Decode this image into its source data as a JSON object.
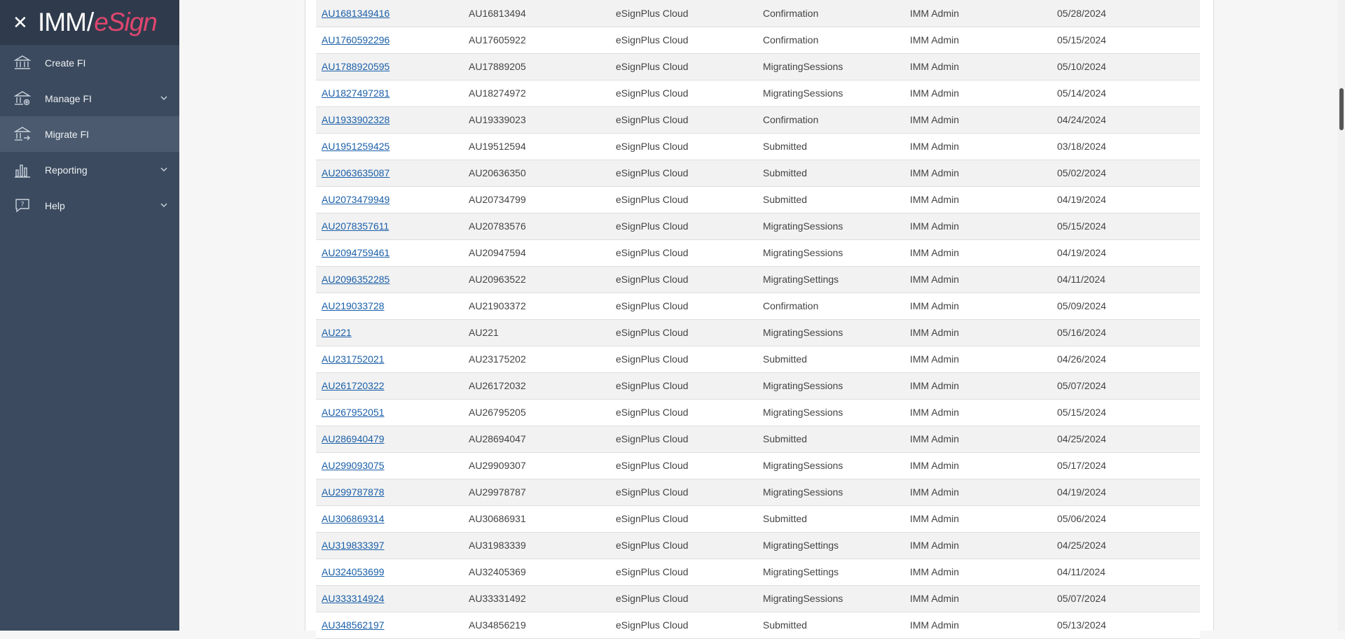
{
  "app": {
    "logo_imm": "IMM",
    "logo_slash": "/",
    "logo_esign": "eSign"
  },
  "sidebar": {
    "items": [
      {
        "label": "Create FI",
        "icon": "bank-icon"
      },
      {
        "label": "Manage FI",
        "icon": "bank-settings-icon"
      },
      {
        "label": "Migrate FI",
        "icon": "bank-migrate-icon"
      },
      {
        "label": "Reporting",
        "icon": "bar-chart-icon"
      },
      {
        "label": "Help",
        "icon": "help-bubble-icon"
      }
    ]
  },
  "table": {
    "rows": [
      [
        "AU1681349416",
        "AU16813494",
        "eSignPlus Cloud",
        "Confirmation",
        "IMM Admin",
        "05/28/2024"
      ],
      [
        "AU1760592296",
        "AU17605922",
        "eSignPlus Cloud",
        "Confirmation",
        "IMM Admin",
        "05/15/2024"
      ],
      [
        "AU1788920595",
        "AU17889205",
        "eSignPlus Cloud",
        "MigratingSessions",
        "IMM Admin",
        "05/10/2024"
      ],
      [
        "AU1827497281",
        "AU18274972",
        "eSignPlus Cloud",
        "MigratingSessions",
        "IMM Admin",
        "05/14/2024"
      ],
      [
        "AU1933902328",
        "AU19339023",
        "eSignPlus Cloud",
        "Confirmation",
        "IMM Admin",
        "04/24/2024"
      ],
      [
        "AU1951259425",
        "AU19512594",
        "eSignPlus Cloud",
        "Submitted",
        "IMM Admin",
        "03/18/2024"
      ],
      [
        "AU2063635087",
        "AU20636350",
        "eSignPlus Cloud",
        "Submitted",
        "IMM Admin",
        "05/02/2024"
      ],
      [
        "AU2073479949",
        "AU20734799",
        "eSignPlus Cloud",
        "Submitted",
        "IMM Admin",
        "04/19/2024"
      ],
      [
        "AU2078357611",
        "AU20783576",
        "eSignPlus Cloud",
        "MigratingSessions",
        "IMM Admin",
        "05/15/2024"
      ],
      [
        "AU2094759461",
        "AU20947594",
        "eSignPlus Cloud",
        "MigratingSessions",
        "IMM Admin",
        "04/19/2024"
      ],
      [
        "AU2096352285",
        "AU20963522",
        "eSignPlus Cloud",
        "MigratingSettings",
        "IMM Admin",
        "04/11/2024"
      ],
      [
        "AU219033728",
        "AU21903372",
        "eSignPlus Cloud",
        "Confirmation",
        "IMM Admin",
        "05/09/2024"
      ],
      [
        "AU221",
        "AU221",
        "eSignPlus Cloud",
        "MigratingSessions",
        "IMM Admin",
        "05/16/2024"
      ],
      [
        "AU231752021",
        "AU23175202",
        "eSignPlus Cloud",
        "Submitted",
        "IMM Admin",
        "04/26/2024"
      ],
      [
        "AU261720322",
        "AU26172032",
        "eSignPlus Cloud",
        "MigratingSessions",
        "IMM Admin",
        "05/07/2024"
      ],
      [
        "AU267952051",
        "AU26795205",
        "eSignPlus Cloud",
        "MigratingSessions",
        "IMM Admin",
        "05/15/2024"
      ],
      [
        "AU286940479",
        "AU28694047",
        "eSignPlus Cloud",
        "Submitted",
        "IMM Admin",
        "04/25/2024"
      ],
      [
        "AU299093075",
        "AU29909307",
        "eSignPlus Cloud",
        "MigratingSessions",
        "IMM Admin",
        "05/17/2024"
      ],
      [
        "AU299787878",
        "AU29978787",
        "eSignPlus Cloud",
        "MigratingSessions",
        "IMM Admin",
        "04/19/2024"
      ],
      [
        "AU306869314",
        "AU30686931",
        "eSignPlus Cloud",
        "Submitted",
        "IMM Admin",
        "05/06/2024"
      ],
      [
        "AU319833397",
        "AU31983339",
        "eSignPlus Cloud",
        "MigratingSettings",
        "IMM Admin",
        "04/25/2024"
      ],
      [
        "AU324053699",
        "AU32405369",
        "eSignPlus Cloud",
        "MigratingSettings",
        "IMM Admin",
        "04/11/2024"
      ],
      [
        "AU333314924",
        "AU33331492",
        "eSignPlus Cloud",
        "MigratingSessions",
        "IMM Admin",
        "05/07/2024"
      ],
      [
        "AU348562197",
        "AU34856219",
        "eSignPlus Cloud",
        "Submitted",
        "IMM Admin",
        "05/13/2024"
      ]
    ]
  }
}
